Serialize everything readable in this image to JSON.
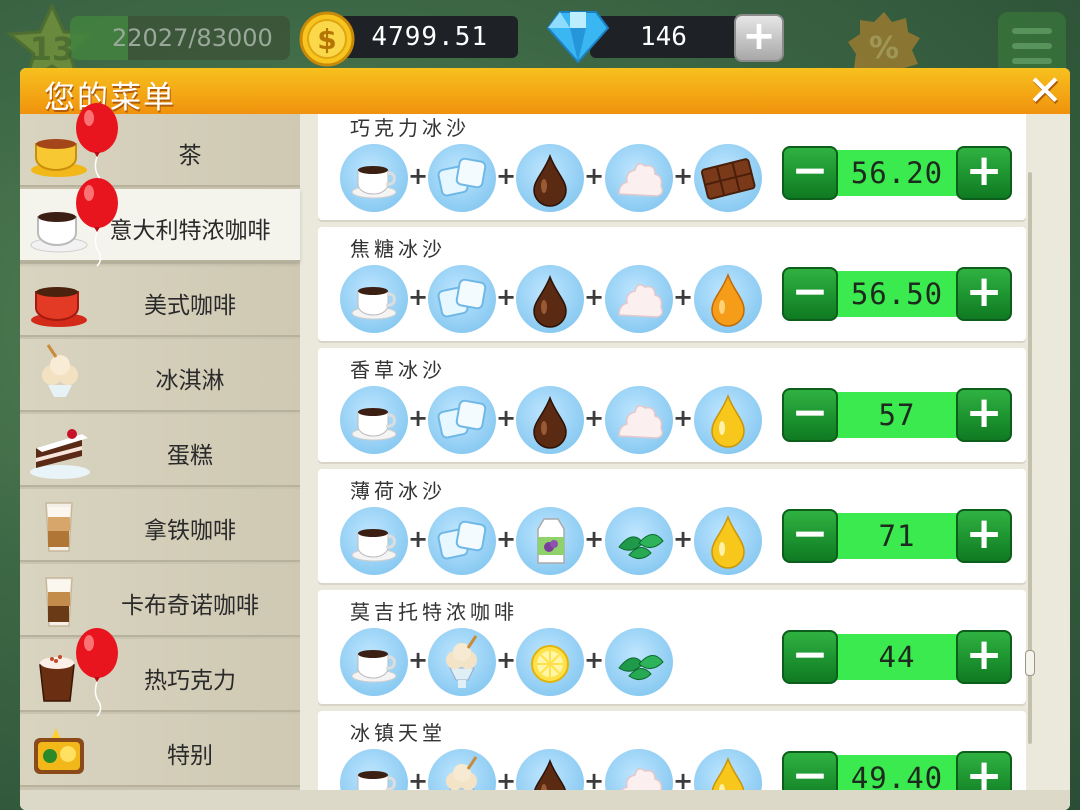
{
  "hud": {
    "level": "13",
    "xp_text": "22027/83000",
    "xp_progress": 0.265,
    "coins": "4799.51",
    "gems": "146",
    "gem_plus_label": "+",
    "icons": [
      "star-level-icon",
      "coin-icon",
      "diamond-icon",
      "discount-percent-icon",
      "menu-list-icon"
    ]
  },
  "panel": {
    "title": "您的菜单",
    "close_label": "✕"
  },
  "categories": [
    {
      "label": "茶",
      "icon": "tea-cup-icon",
      "balloon": true,
      "active": false
    },
    {
      "label": "意大利特浓咖啡",
      "icon": "espresso-cup-icon",
      "balloon": true,
      "active": true
    },
    {
      "label": "美式咖啡",
      "icon": "american-coffee-icon",
      "balloon": false,
      "active": false
    },
    {
      "label": "冰淇淋",
      "icon": "ice-cream-icon",
      "balloon": false,
      "active": false
    },
    {
      "label": "蛋糕",
      "icon": "cake-icon",
      "balloon": false,
      "active": false
    },
    {
      "label": "拿铁咖啡",
      "icon": "latte-icon",
      "balloon": false,
      "active": false
    },
    {
      "label": "卡布奇诺咖啡",
      "icon": "cappuccino-icon",
      "balloon": false,
      "active": false
    },
    {
      "label": "热巧克力",
      "icon": "hot-chocolate-icon",
      "balloon": true,
      "active": false
    },
    {
      "label": "特别",
      "icon": "special-icon",
      "balloon": false,
      "active": false
    }
  ],
  "recipes": [
    {
      "name": "巧克力冰沙",
      "ingredients": [
        "espresso",
        "ice",
        "chocolate-syrup",
        "whipped-cream",
        "chocolate-bar"
      ],
      "price": "56.20"
    },
    {
      "name": "焦糖冰沙",
      "ingredients": [
        "espresso",
        "ice",
        "chocolate-syrup",
        "whipped-cream",
        "caramel-drop"
      ],
      "price": "56.50"
    },
    {
      "name": "香草冰沙",
      "ingredients": [
        "espresso",
        "ice",
        "chocolate-syrup",
        "whipped-cream",
        "vanilla-drop"
      ],
      "price": "57"
    },
    {
      "name": "薄荷冰沙",
      "ingredients": [
        "espresso",
        "ice",
        "milk-carton",
        "mint-leaves",
        "vanilla-drop"
      ],
      "price": "71"
    },
    {
      "name": "莫吉托特浓咖啡",
      "ingredients": [
        "espresso",
        "ice-cream",
        "lemon",
        "mint-leaves"
      ],
      "price": "44"
    },
    {
      "name": "冰镇天堂",
      "ingredients": [
        "espresso",
        "ice-cream",
        "chocolate-syrup",
        "whipped-cream",
        "vanilla-drop"
      ],
      "price": "49.40"
    }
  ],
  "plus_sign": "+",
  "stepper": {
    "minus": "−",
    "plus": "+"
  },
  "colors": {
    "header_orange": "#f0920d",
    "price_green": "#3bea4e",
    "button_green": "#0f7a22",
    "ingredient_blue": "#8ccbf2"
  }
}
